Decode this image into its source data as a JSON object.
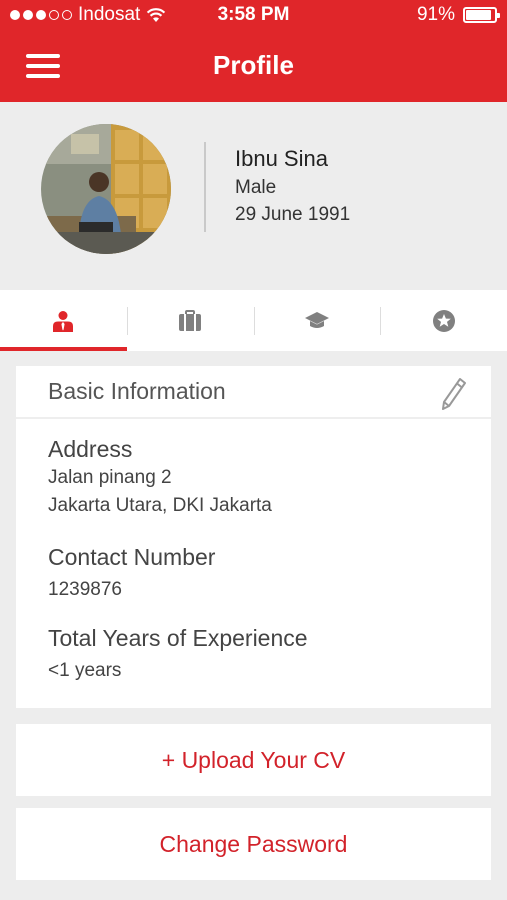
{
  "status_bar": {
    "carrier": "Indosat",
    "signal_bars_filled": 3,
    "signal_bars_total": 5,
    "time": "3:58 PM",
    "battery": "91%",
    "battery_level": 0.91
  },
  "header": {
    "title": "Profile",
    "menu_icon": "hamburger-menu-icon"
  },
  "profile": {
    "name": "Ibnu Sina",
    "gender": "Male",
    "dob": "29 June 1991"
  },
  "tabs": [
    {
      "icon": "user-tie-icon",
      "active": true
    },
    {
      "icon": "briefcase-icon",
      "active": false
    },
    {
      "icon": "graduation-cap-icon",
      "active": false
    },
    {
      "icon": "star-badge-icon",
      "active": false
    }
  ],
  "basic_info": {
    "title": "Basic Information",
    "edit_icon": "pencil-icon",
    "address_label": "Address",
    "address_line1": "Jalan pinang 2",
    "address_line2": "Jakarta Utara, DKI Jakarta",
    "contact_label": "Contact Number",
    "contact_value": "1239876",
    "experience_label": "Total Years of Experience",
    "experience_value": "<1 years"
  },
  "actions": {
    "upload_cv": "+ Upload Your CV",
    "change_password": "Change Password"
  },
  "colors": {
    "brand_red": "#e0262a",
    "background": "#ededed"
  }
}
